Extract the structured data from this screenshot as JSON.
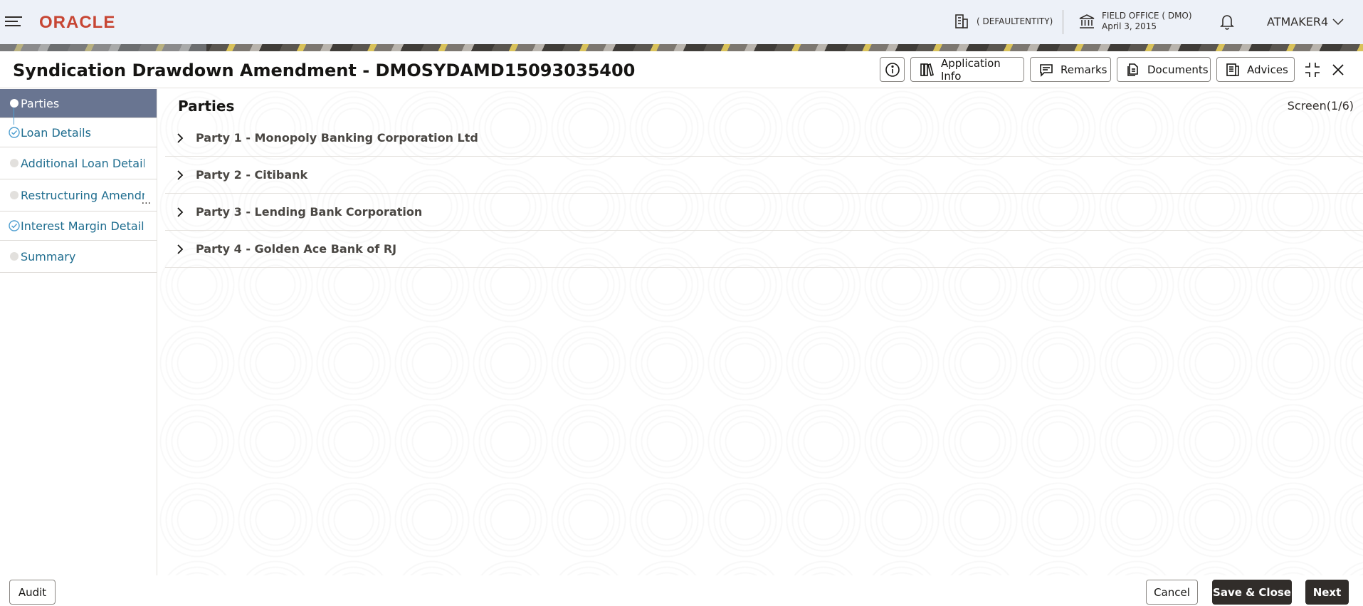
{
  "header": {
    "logo": "ORACLE",
    "entity": "( DEFAULTENTITY)",
    "office_name": "FIELD OFFICE ( DMO)",
    "office_date": "April 3, 2015",
    "user": "ATMAKER4"
  },
  "window": {
    "title": "Syndication Drawdown Amendment - DMOSYDAMD15093035400",
    "buttons": {
      "application_info": "Application Info",
      "remarks": "Remarks",
      "documents": "Documents",
      "advices": "Advices"
    }
  },
  "sidebar": {
    "steps": [
      {
        "label": "Parties",
        "state": "active"
      },
      {
        "label": "Loan Details",
        "state": "completed"
      },
      {
        "label": "Additional Loan Details",
        "state": "pending"
      },
      {
        "label": "Restructuring Amendm",
        "state": "pending",
        "ellipsis": "..."
      },
      {
        "label": "Interest Margin Details",
        "state": "completed"
      },
      {
        "label": "Summary",
        "state": "pending"
      }
    ]
  },
  "main": {
    "title": "Parties",
    "screen_indicator": "Screen(1/6)",
    "parties": [
      "Party  1  -  Monopoly Banking Corporation Ltd",
      "Party  2  -  Citibank",
      "Party  3  -  Lending Bank Corporation",
      "Party  4  -  Golden Ace Bank of RJ"
    ]
  },
  "footer": {
    "audit": "Audit",
    "cancel": "Cancel",
    "save_close": "Save & Close",
    "next": "Next"
  },
  "colors": {
    "brand": "#c74634",
    "active_step": "#697591",
    "link": "#1f6d8f",
    "primary_button": "#312d2a"
  }
}
